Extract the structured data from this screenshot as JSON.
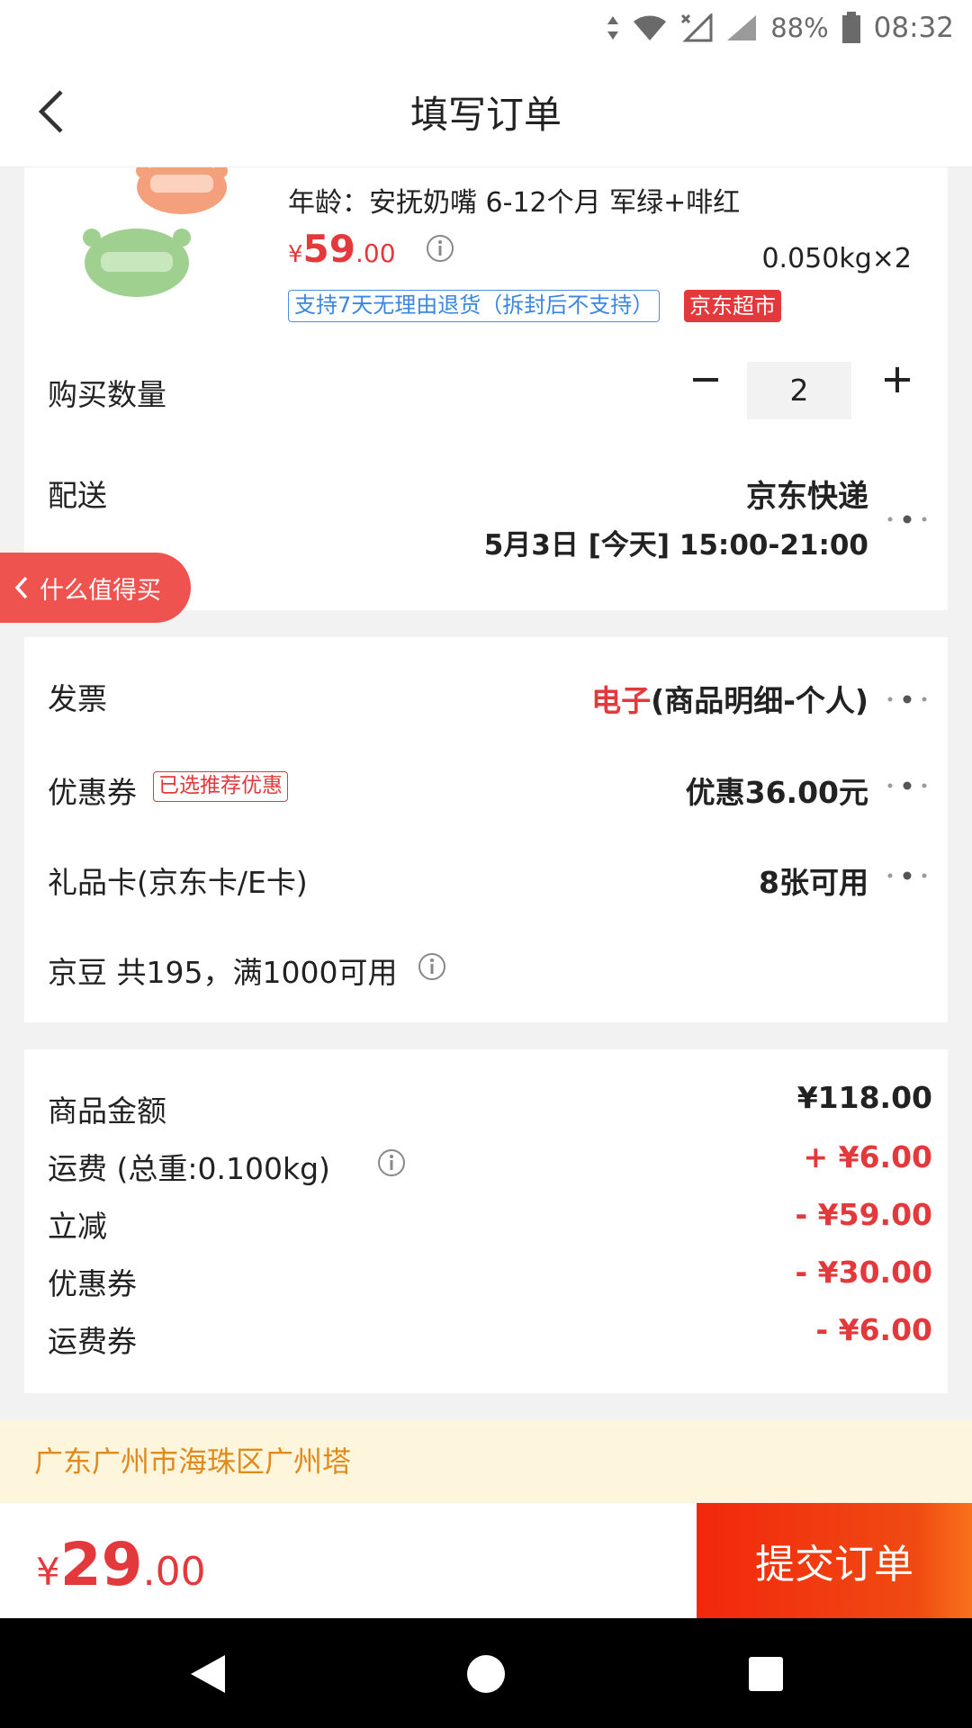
{
  "status_bar": {
    "battery": "88%",
    "time": "08:32"
  },
  "header": {
    "title": "填写订单"
  },
  "product": {
    "attributes": "年龄：安抚奶嘴 6-12个月 军绿+啡红",
    "price_yen": "¥",
    "price_int": "59",
    "price_dec": ".00",
    "weight": "0.050kg×2",
    "return_tag": "支持7天无理由退货（拆封后不支持）",
    "store_tag": "京东超市"
  },
  "quantity": {
    "label": "购买数量",
    "value": "2"
  },
  "delivery": {
    "label": "配送",
    "method": "京东快递",
    "time": "5月3日 [今天] 15:00-21:00"
  },
  "float_tab": {
    "label": "什么值得买"
  },
  "invoice": {
    "label": "发票",
    "type": "电子",
    "detail": "(商品明细-个人)"
  },
  "coupon": {
    "label": "优惠券",
    "tag": "已选推荐优惠",
    "value": "优惠36.00元"
  },
  "gift_card": {
    "label": "礼品卡(京东卡/E卡)",
    "value": "8张可用"
  },
  "jd_beans": {
    "label": "京豆 共195，满1000可用"
  },
  "amounts": [
    {
      "label": "商品金额",
      "value": "¥118.00",
      "color": "black"
    },
    {
      "label": "运费 (总重:0.100kg)",
      "value": "+ ¥6.00",
      "color": "red"
    },
    {
      "label": "立减",
      "value": "- ¥59.00",
      "color": "red"
    },
    {
      "label": "优惠券",
      "value": "- ¥30.00",
      "color": "red"
    },
    {
      "label": "运费券",
      "value": "- ¥6.00",
      "color": "red"
    }
  ],
  "address": "广东广州市海珠区广州塔",
  "total": {
    "yen": "¥",
    "int": "29",
    "dec": ".00"
  },
  "submit_label": "提交订单",
  "colors": {
    "accent": "#e4393c",
    "address_bg": "#fdf6dc",
    "address_text": "#e08a1e"
  }
}
